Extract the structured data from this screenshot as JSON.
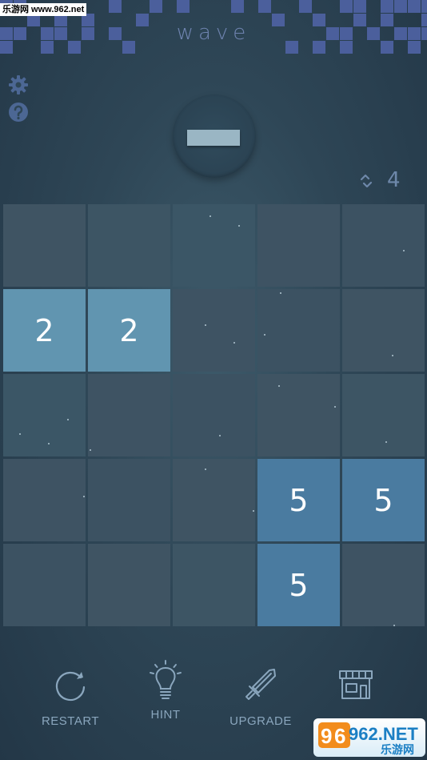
{
  "watermark_top": "乐游网 www.962.net",
  "title": "wave",
  "moves": "4",
  "colors": {
    "bg": "#2e4656",
    "tile_empty": "#3c5161",
    "tile_2": "#6195b0",
    "tile_5": "#4a7ba0",
    "mosaic": "#4b5f9c",
    "accent_text": "#6e88aa"
  },
  "icons": {
    "settings": "gear-icon",
    "help": "help-icon",
    "moves": "swap-icon"
  },
  "board": {
    "size": 5,
    "tiles": [
      [
        "",
        "",
        "",
        "",
        ""
      ],
      [
        "2",
        "2",
        "",
        "",
        ""
      ],
      [
        "",
        "",
        "",
        "",
        ""
      ],
      [
        "",
        "",
        "",
        "5",
        "5"
      ],
      [
        "",
        "",
        "",
        "5",
        ""
      ]
    ]
  },
  "toolbar": {
    "restart": "RESTART",
    "hint": "HINT",
    "upgrade": "UPGRADE"
  },
  "watermark_bottom": {
    "top_text": "962.NET",
    "bottom_text": "乐游网"
  }
}
